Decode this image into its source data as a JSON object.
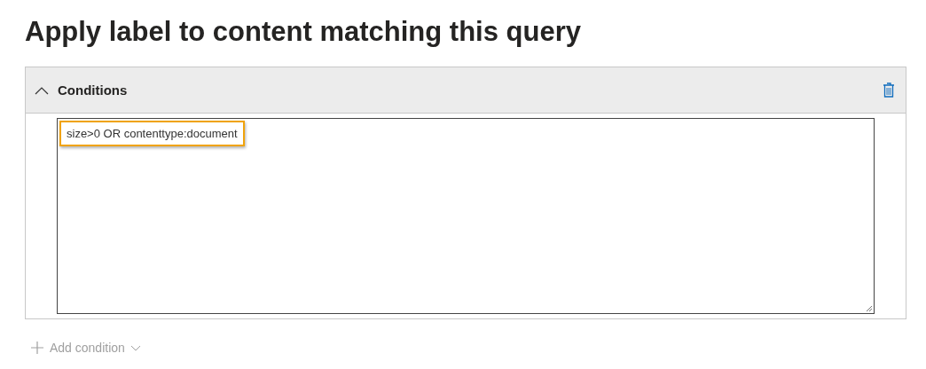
{
  "heading": "Apply label to content matching this query",
  "conditions": {
    "title": "Conditions",
    "expanded": true,
    "query": {
      "value": "size>0 OR contenttype:document",
      "highlighted": true
    }
  },
  "add_condition": {
    "label": "Add condition",
    "disabled": true
  }
}
